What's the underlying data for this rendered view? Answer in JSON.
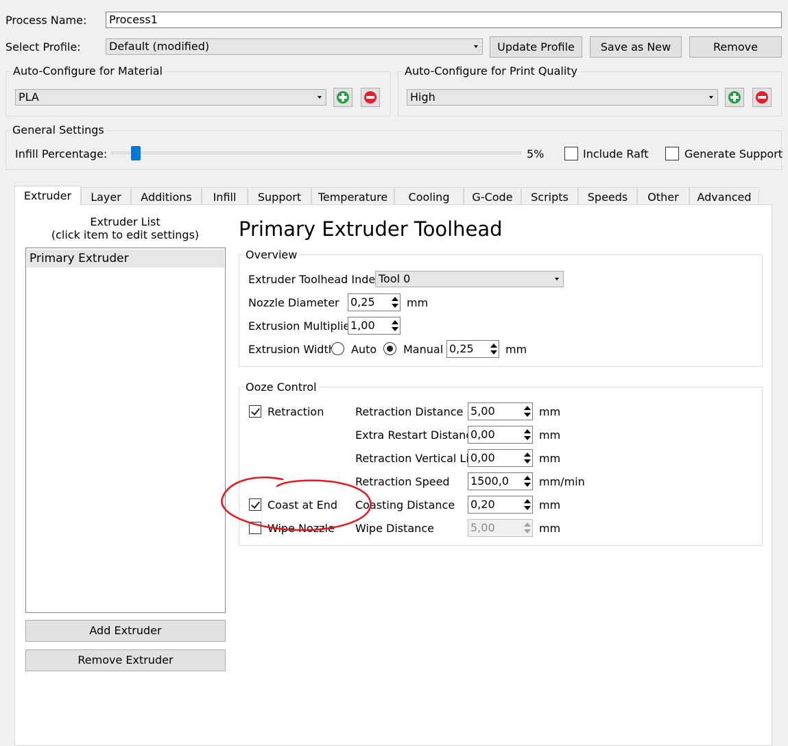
{
  "process": {
    "label": "Process Name:",
    "value": "Process1"
  },
  "profile": {
    "label": "Select Profile:",
    "value": "Default (modified)",
    "update_button": "Update Profile",
    "save_new_button": "Save as New",
    "remove_button": "Remove"
  },
  "material": {
    "title": "Auto-Configure for Material",
    "value": "PLA"
  },
  "quality": {
    "title": "Auto-Configure for Print Quality",
    "value": "High"
  },
  "general": {
    "title": "General Settings",
    "infill_label": "Infill Percentage:",
    "infill_value_text": "5%",
    "infill_fraction": 0.05,
    "include_raft": {
      "label": "Include Raft",
      "checked": false
    },
    "generate_support": {
      "label": "Generate Support",
      "checked": false
    }
  },
  "tabs": [
    {
      "label": "Extruder",
      "active": true
    },
    {
      "label": "Layer"
    },
    {
      "label": "Additions"
    },
    {
      "label": "Infill"
    },
    {
      "label": "Support"
    },
    {
      "label": "Temperature"
    },
    {
      "label": "Cooling"
    },
    {
      "label": "G-Code"
    },
    {
      "label": "Scripts"
    },
    {
      "label": "Speeds"
    },
    {
      "label": "Other"
    },
    {
      "label": "Advanced"
    }
  ],
  "extruder_list": {
    "title_line1": "Extruder List",
    "title_line2": "(click item to edit settings)",
    "items": [
      "Primary Extruder"
    ],
    "add_button": "Add Extruder",
    "remove_button": "Remove Extruder"
  },
  "toolhead": {
    "heading": "Primary Extruder Toolhead",
    "overview_title": "Overview",
    "index_label": "Extruder Toolhead Index",
    "index_value": "Tool 0",
    "nozzle_label": "Nozzle Diameter",
    "nozzle_value": "0,25",
    "nozzle_unit": "mm",
    "multiplier_label": "Extrusion Multiplier",
    "multiplier_value": "1,00",
    "width_label": "Extrusion Width",
    "width_auto": "Auto",
    "width_manual": "Manual",
    "width_value": "0,25",
    "width_unit": "mm"
  },
  "ooze": {
    "title": "Ooze Control",
    "retraction_check": "Retraction",
    "coast_check": "Coast at End",
    "wipe_check": "Wipe Nozzle",
    "rows": [
      {
        "label": "Retraction Distance",
        "value": "5,00",
        "unit": "mm"
      },
      {
        "label": "Extra Restart Distance",
        "value": "0,00",
        "unit": "mm"
      },
      {
        "label": "Retraction Vertical Lift",
        "value": "0,00",
        "unit": "mm"
      },
      {
        "label": "Retraction Speed",
        "value": "1500,0",
        "unit": "mm/min"
      },
      {
        "label": "Coasting Distance",
        "value": "0,20",
        "unit": "mm"
      },
      {
        "label": "Wipe Distance",
        "value": "5,00",
        "unit": "mm"
      }
    ]
  },
  "colors": {
    "annotation": "#e8161b",
    "slider_handle": "#0078d7",
    "list_selection": "#e5e5e5"
  }
}
